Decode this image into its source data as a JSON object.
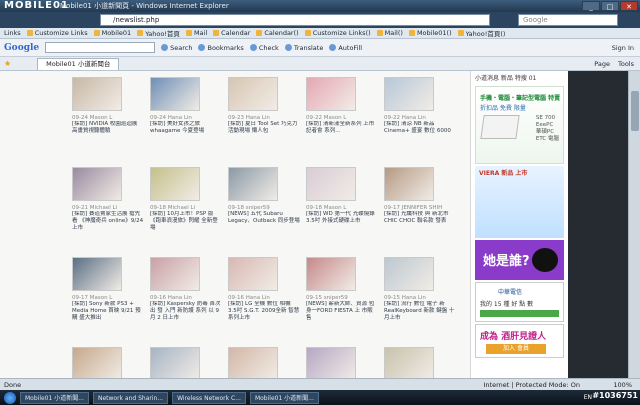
{
  "window": {
    "title": "Mobile01 小道新聞頁 - Windows Internet Explorer",
    "logo_text": "MOBILE01",
    "buttons": [
      "_",
      "□",
      "✕"
    ]
  },
  "address": {
    "url": "/newslist.php",
    "search_placeholder": "Google"
  },
  "links_bar": {
    "label": "Links",
    "items": [
      "Customize Links",
      "Mobile01",
      "Yahoo!首頁",
      "Mail",
      "Calendar",
      "Calendar()",
      "Customize Links()",
      "Mail()",
      "Mobile01()",
      "Yahoo!首頁()"
    ]
  },
  "google_bar": {
    "logo": "Google",
    "search_button": "Search",
    "bookmarks": "Bookmarks",
    "check": "Check",
    "translate": "Translate",
    "autofill": "AutoFill",
    "signin": "Sign In"
  },
  "tab": {
    "title": "Mobile01 小道新聞台",
    "page_menu": "Page",
    "tools_menu": "Tools"
  },
  "articles": [
    {
      "meta": "09-24  Mason L",
      "title": "[採訪] NVIDIA 校園巡迴展 高畫質視聽體驗"
    },
    {
      "meta": "09-24  Hana Lin",
      "title": "[採訪] 美好女孩之旅 whaagame 今夏登場"
    },
    {
      "meta": "09-23  Hana Lin",
      "title": "[採訪] 夏日 Tool Set 巧克力 活動現場 懶人包"
    },
    {
      "meta": "09-22  Mason L",
      "title": "[採訪] 清新漾全新系列 上市記者會 系列..."
    },
    {
      "meta": "09-22  Hana Lin",
      "title": "[採訪] 清涼 NB 新品 Cinema+ 盛宴 數位 6000"
    },
    {
      "meta": "09-21  Michael Li",
      "title": "[採訪] 賽道賣家生活展 搶先看 《神魔奇兵 online》9/24上市"
    },
    {
      "meta": "09-18  Michael Li",
      "title": "[採訪] 10月上市！PSP 版 《跑車浪漫旅》閃耀 全新登場"
    },
    {
      "meta": "09-18  sniper59",
      "title": "[NEWS] 五代 Subaru Legacy、Outback 同步登場"
    },
    {
      "meta": "09-18  Mason L",
      "title": "[採訪] WD 第一代 光碟燒錄 3.5吋 外接式硬碟上市"
    },
    {
      "meta": "09-17  JENNIFER SHIH",
      "title": "[採訪] 光纖科技 與 新北市 CHIC CHOC 聯名款 發表"
    },
    {
      "meta": "09-17  Mason L",
      "title": "[採訪] Sony 新款 PS3 + Media Home 首映 9/21 預購 盛大推出"
    },
    {
      "meta": "09-16  Hana Lin",
      "title": "[採訪] Kaspersky 防毒 首次出 發 入門 新防護 系列 以 9月 2 日上市"
    },
    {
      "meta": "09-16  Hana Lin",
      "title": "[採訪] LG 全機 數位 相機 3.5吋 S.G.T. 2009全新 智慧 系列上市"
    },
    {
      "meta": "09-15  sniper59",
      "title": "[NEWS] 嶄新大師、資源 包 身一FORD FIESTA 上 市販售"
    },
    {
      "meta": "09-15  Hana Lin",
      "title": "[採訪] 流行 數位 電子 新 RealKeyboard 新款 鍵盤 十月上市"
    },
    {
      "meta": "",
      "title": ""
    },
    {
      "meta": "",
      "title": ""
    },
    {
      "meta": "",
      "title": ""
    },
    {
      "meta": "",
      "title": ""
    },
    {
      "meta": "",
      "title": ""
    }
  ],
  "sidebar": {
    "header": "小道消息 新品 特搜 01",
    "ad1_line1": "手機・電腦・筆記型電腦 特賣",
    "ad1_line2": "折扣品 免費 限量",
    "ad1_badges": [
      "SE 700",
      "EeePC",
      "華碩PC",
      "ETC 電腦"
    ],
    "ad2_title": "VIERA 新品 上市",
    "ad3_text": "她是誰?",
    "ad4_bank": "中華電信",
    "ad4_offer": "我的 15 種 好 點 數",
    "ad5_cta": "成為 酒肝見證人",
    "ad5_button": "加入 會員"
  },
  "status": {
    "left": "Done",
    "zone": "Internet | Protected Mode: On",
    "zoom": "100%"
  },
  "taskbar": {
    "items": [
      "Mobile01 小道新聞...",
      "Network and Sharin...",
      "Wireless Network C...",
      "Mobile01 小道新聞..."
    ],
    "lang": "EN",
    "watermark": "#1036751"
  },
  "colors": {
    "titlebar": "#23384f",
    "accent_purple": "#8b3bc9",
    "ad_green": "#4aa84a"
  }
}
